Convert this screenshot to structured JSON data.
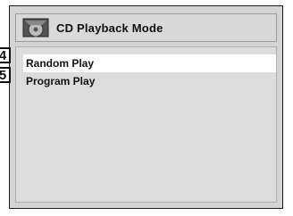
{
  "header": {
    "title": "CD Playback Mode",
    "icon": "disc-icon"
  },
  "menu": {
    "items": [
      {
        "label": "Random Play",
        "selected": true
      },
      {
        "label": "Program Play",
        "selected": false
      }
    ]
  },
  "callouts": [
    "4",
    "5"
  ],
  "colors": {
    "screen_bg": "#d4d4d4",
    "highlight": "#ffffff",
    "text": "#111111"
  }
}
